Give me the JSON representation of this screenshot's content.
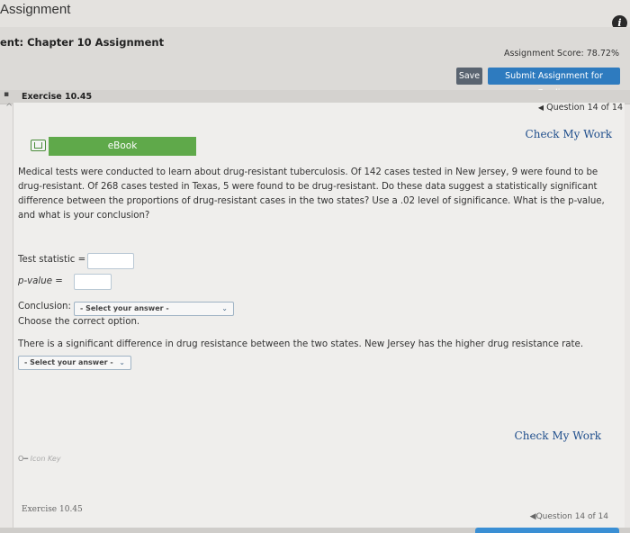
{
  "app": {
    "title": "Assignment",
    "info_icon": "info-icon"
  },
  "header": {
    "assignment_title": "ent: Chapter 10 Assignment",
    "score": "Assignment Score: 78.72%",
    "save_label": "Save",
    "submit_label": "Submit Assignment for Grading"
  },
  "exercise": {
    "label": "Exercise 10.45",
    "question_nav": "Question 14 of 14",
    "check_my_work": "Check My Work",
    "ebook_label": "eBook"
  },
  "problem": {
    "text": "Medical tests were conducted to learn about drug-resistant tuberculosis. Of 142 cases tested in New Jersey, 9 were found to be drug-resistant. Of 268 cases tested in Texas, 5 were found to be drug-resistant. Do these data suggest a statistically significant difference between the proportions of drug-resistant cases in the two states? Use a .02 level of significance. What is the p-value, and what is your conclusion?",
    "test_statistic_label": "Test statistic =",
    "test_statistic_value": "",
    "p_value_label": "p-value =",
    "p_value_value": "",
    "conclusion_label": "Conclusion:",
    "conclusion_select": "- Select your answer -",
    "choose_text": "Choose the correct option.",
    "statement": "There is a significant difference in drug resistance between the two states. New Jersey has the higher drug resistance rate.",
    "statement_select": "- Select your answer -"
  },
  "footer": {
    "check_my_work": "Check My Work",
    "icon_key": "Icon Key",
    "exercise_label": "Exercise 10.45",
    "question_nav": "Question 14 of 14"
  }
}
